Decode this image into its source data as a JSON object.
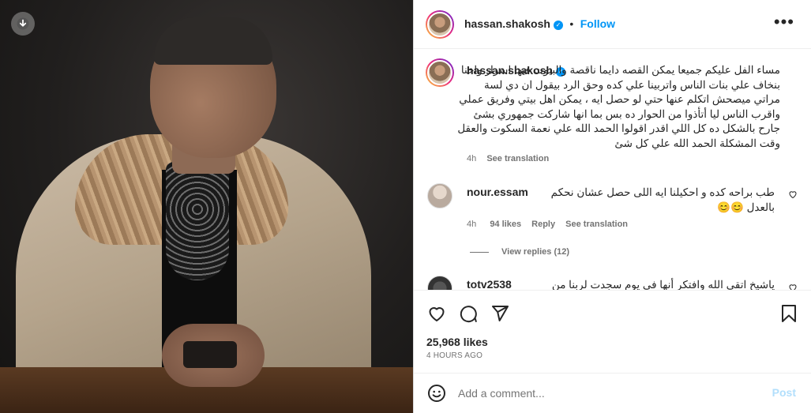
{
  "post": {
    "username": "hassan.shakosh",
    "verified_mark": "✓",
    "follow_label": "Follow",
    "separator": "•",
    "more_label": "•••"
  },
  "caption": {
    "username": "hassan.shakosh",
    "text": "مساء الفل عليكم جميعا يمكن القصه دايما ناقصة والبيوت فيها اسرار واحنا بنخاف علي بنات الناس واتربينا علي كده وحق الرد بيقول ان دي لسة مراتي ميصحش اتكلم عنها حتي لو حصل ايه ، يمكن اهل بيتي وفريق عملي واقرب الناس ليا أتأذوا من الحوار ده بس بما انها شاركت جمهوري بشئ جارح بالشكل ده كل اللي اقدر اقولوا الحمد الله علي نعمة السكوت والعقل وقت المشكلة الحمد الله علي كل شئ",
    "time": "4h",
    "see_translation": "See translation"
  },
  "comments": [
    {
      "username": "nour.essam",
      "text": "طب براحه كده و احكيلنا ايه اللى حصل عشان نحكم بالعدل 😊😊",
      "time": "4h",
      "likes": "94 likes",
      "reply": "Reply",
      "see_translation": "See translation",
      "view_replies": "View replies (12)"
    },
    {
      "username": "totv2538",
      "text": "ياشيخ اتقي الله وافتكر أنها في يوم سجدت لربنا من"
    }
  ],
  "actions": {
    "like_icon": "heart-icon",
    "comment_icon": "comment-icon",
    "share_icon": "send-icon",
    "save_icon": "bookmark-icon",
    "likes_count": "25,968 likes",
    "posted": "4 HOURS AGO"
  },
  "add_comment": {
    "emoji_icon": "emoji-icon",
    "placeholder": "Add a comment...",
    "post_label": "Post"
  },
  "image": {
    "download_icon": "download-icon"
  },
  "colors": {
    "accent": "#0095f6",
    "text": "#262626",
    "muted": "#737373",
    "post_disabled": "#b2dffc"
  }
}
